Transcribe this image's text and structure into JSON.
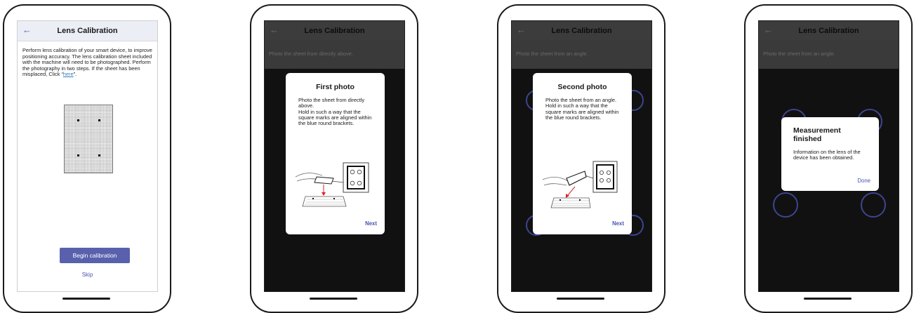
{
  "screens": [
    {
      "header": {
        "back_icon": "arrow-left-icon",
        "title": "Lens Calibration"
      },
      "intro": {
        "text": "Perform lens calibration of your smart device, to improve positioning accuracy. The lens calibration sheet included with the machine will need to be photographed. Perform the photography in two steps. If the sheet has been misplaced, Click “",
        "link": "here",
        "end": "”."
      },
      "primary_button": "Begin calibration",
      "secondary_button": "Skip"
    },
    {
      "header": {
        "back_icon": "arrow-left-icon",
        "title": "Lens Calibration"
      },
      "instruction": "Photo the sheet from directly above.",
      "dialog": {
        "title": "First photo",
        "body": "Photo the sheet from directly above.\nHold in such a way that the square marks are aligned within the blue round brackets.",
        "button": "Next"
      }
    },
    {
      "header": {
        "back_icon": "arrow-left-icon",
        "title": "Lens Calibration"
      },
      "instruction": "Photo the sheet from an angle.",
      "dialog": {
        "title": "Second photo",
        "body": "Photo the sheet from an angle.\nHold in such a way that the square marks are aligned within the blue round brackets.",
        "button": "Next"
      }
    },
    {
      "header": {
        "back_icon": "arrow-left-icon",
        "title": "Lens Calibration"
      },
      "instruction": "Photo the sheet from an angle.",
      "dialog": {
        "title": "Measurement finished",
        "body": "Information on the lens of the device has been obtained.",
        "button": "Done"
      }
    }
  ],
  "colors": {
    "accent": "#5961ad",
    "link": "#2f7fc0",
    "bracket": "#3e4490"
  }
}
